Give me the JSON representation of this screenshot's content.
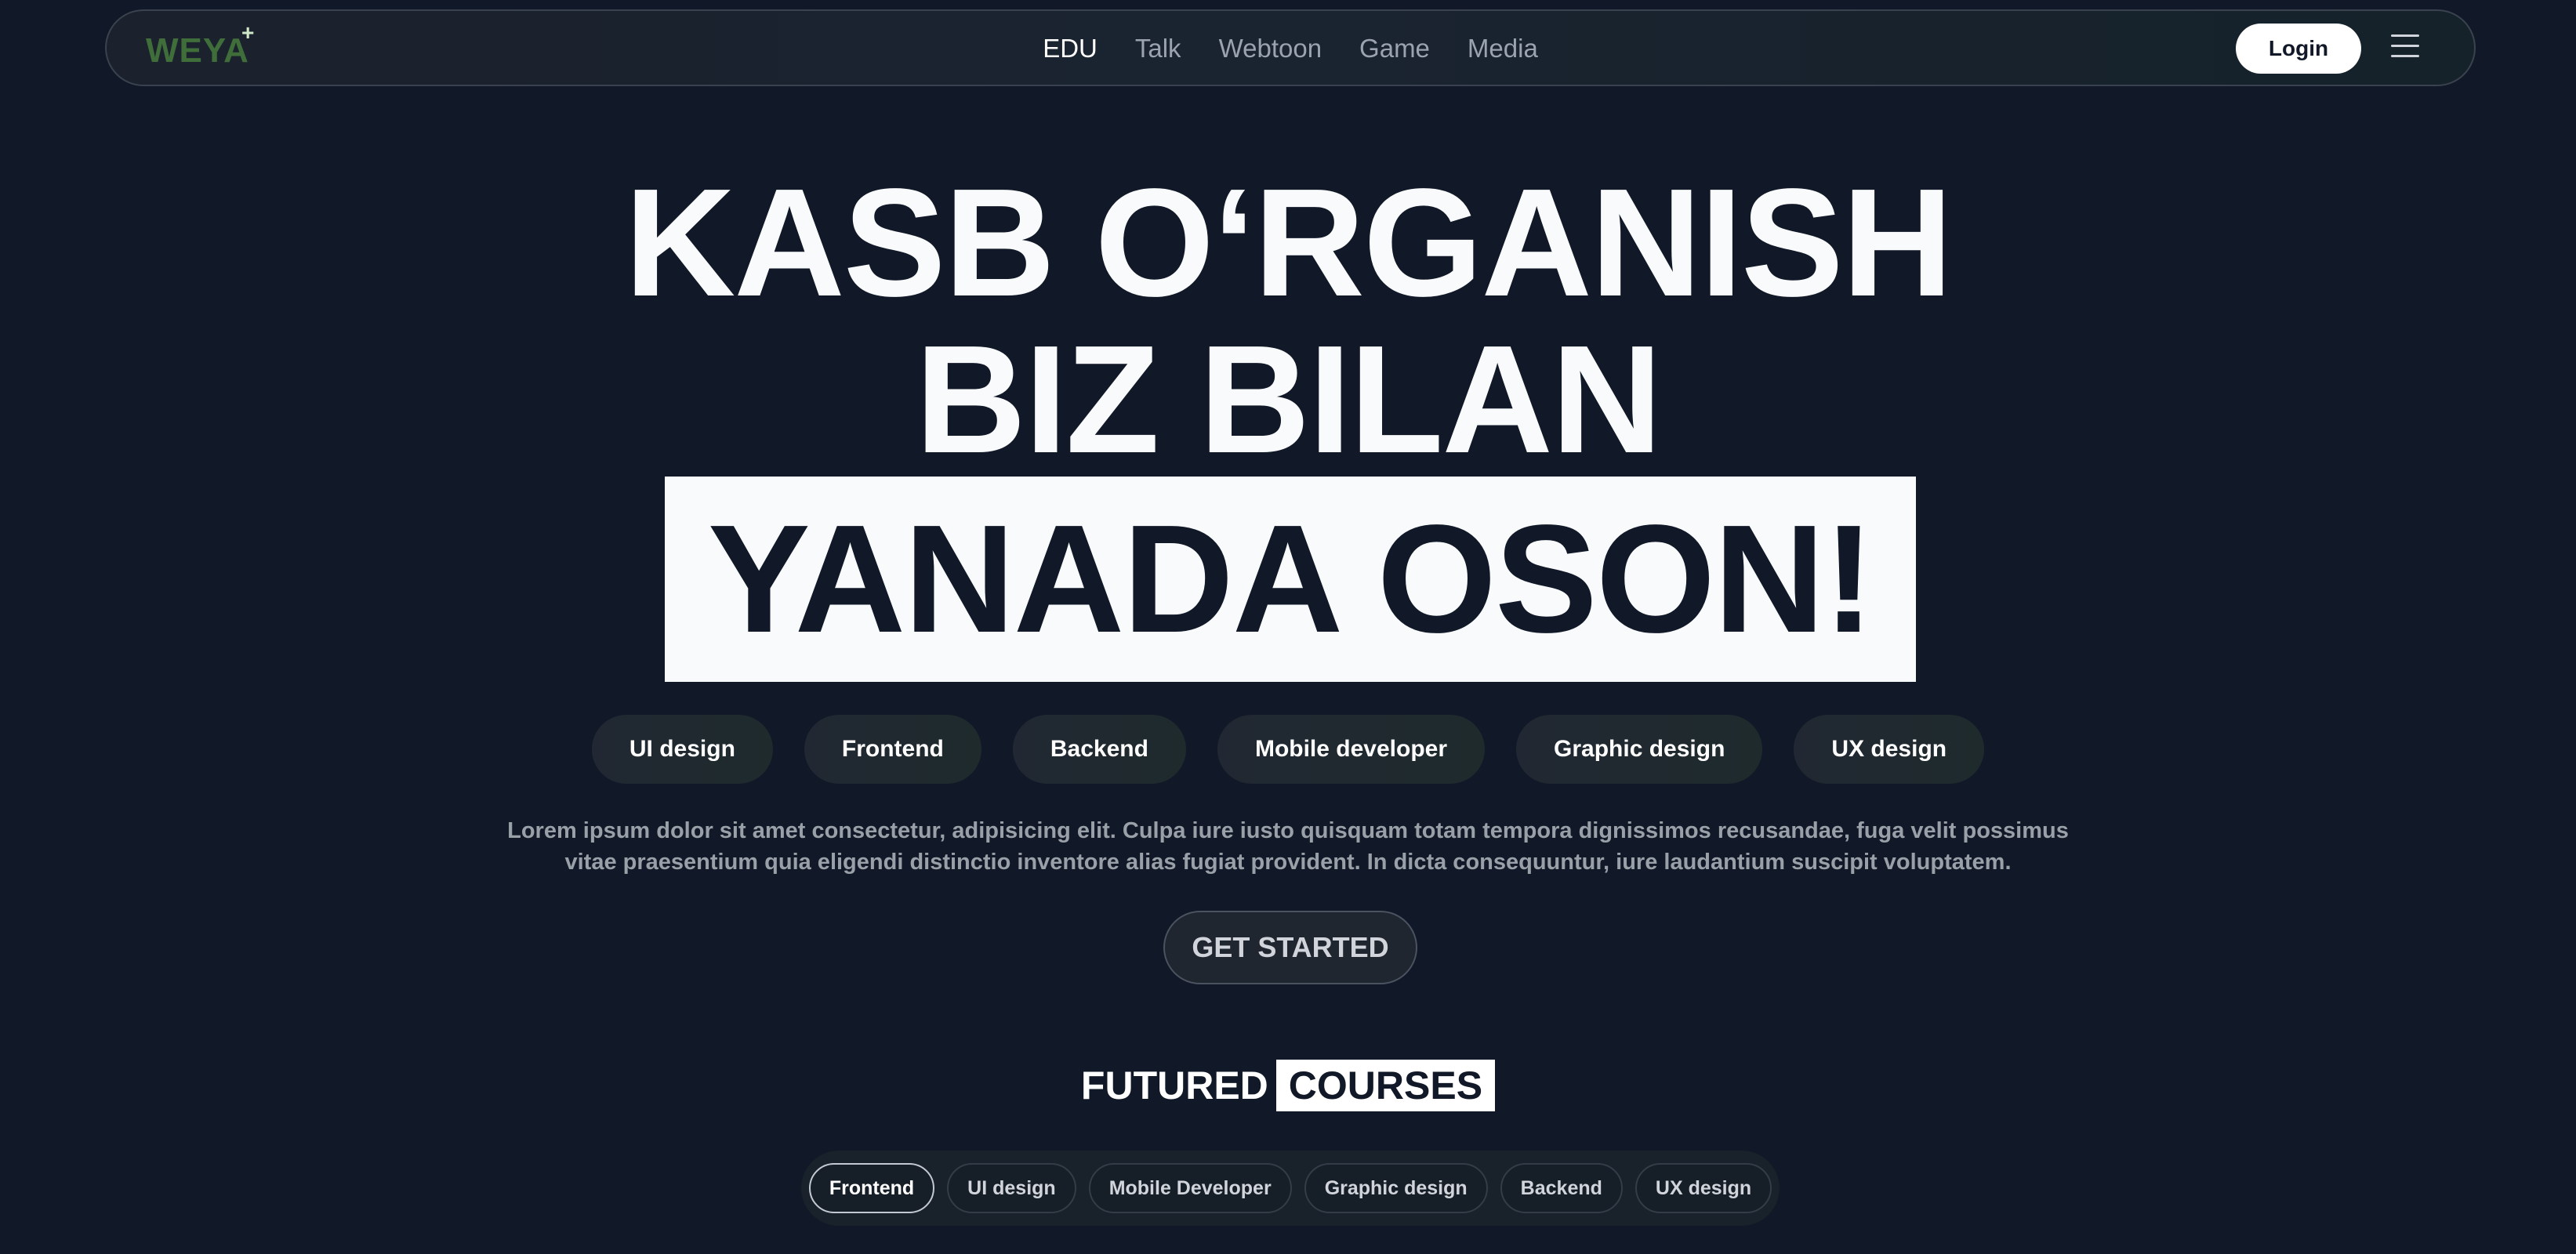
{
  "header": {
    "logo": "WEYA",
    "logo_plus": "+",
    "nav": [
      {
        "label": "EDU",
        "active": true
      },
      {
        "label": "Talk",
        "active": false
      },
      {
        "label": "Webtoon",
        "active": false
      },
      {
        "label": "Game",
        "active": false
      },
      {
        "label": "Media",
        "active": false
      }
    ],
    "login_label": "Login",
    "menu_icon": "hamburger-menu-icon"
  },
  "hero": {
    "line1": "KASB O‘RGANISH",
    "line2": "BIZ BILAN",
    "highlight": "YANADA OSON!"
  },
  "skills": [
    "UI design",
    "Frontend",
    "Backend",
    "Mobile developer",
    "Graphic design",
    "UX design"
  ],
  "description": "Lorem ipsum dolor sit amet consectetur, adipisicing elit. Culpa iure iusto quisquam totam tempora dignissimos recusandae, fuga velit possimus vitae praesentium quia eligendi distinctio inventore alias fugiat provident. In dicta consequuntur, iure laudantium suscipit voluptatem.",
  "cta_label": "GET STARTED",
  "courses": {
    "title_part1": "FUTURED",
    "title_part2": "COURSES",
    "filters": [
      "Frontend",
      "UI design",
      "Mobile Developer",
      "Graphic design",
      "Backend",
      "UX design"
    ],
    "active_filter": "Frontend"
  },
  "colors": {
    "background": "#111827",
    "logo_green": "#3f6e3a",
    "highlight_bg": "#f8fafc"
  }
}
